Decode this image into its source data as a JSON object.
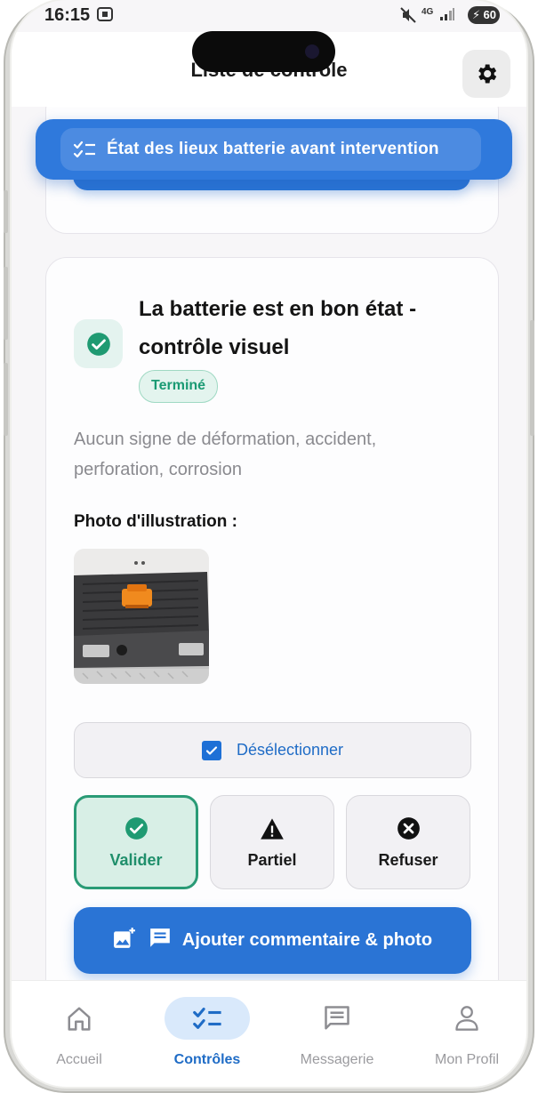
{
  "status_bar": {
    "time": "16:15",
    "network": "4G",
    "battery": "60"
  },
  "app_bar": {
    "title": "Liste de contrôle",
    "settings_icon": "gear-icon"
  },
  "section_banner": {
    "icon": "checklist-icon",
    "label": "État des lieux batterie avant intervention"
  },
  "item": {
    "title": "La batterie est en bon état - contrôle visuel",
    "status_badge": "Terminé",
    "description": "Aucun signe de déformation, accident, perforation, corrosion",
    "photo_label": "Photo d'illustration :",
    "deselect_label": "Désélectionner",
    "choices": [
      {
        "label": "Valider",
        "icon": "check-circle-icon",
        "selected": true
      },
      {
        "label": "Partiel",
        "icon": "warning-icon",
        "selected": false
      },
      {
        "label": "Refuser",
        "icon": "cancel-circle-icon",
        "selected": false
      }
    ],
    "add_comment_label": "Ajouter commentaire & photo"
  },
  "bottom_nav": [
    {
      "label": "Accueil",
      "icon": "home-icon",
      "active": false
    },
    {
      "label": "Contrôles",
      "icon": "checklist-icon",
      "active": true
    },
    {
      "label": "Messagerie",
      "icon": "message-icon",
      "active": false
    },
    {
      "label": "Mon Profil",
      "icon": "person-icon",
      "active": false
    }
  ],
  "colors": {
    "primary": "#2a74d5",
    "success": "#2a9b76",
    "success_bg": "#d8efe6",
    "background": "#f7f6f8"
  }
}
